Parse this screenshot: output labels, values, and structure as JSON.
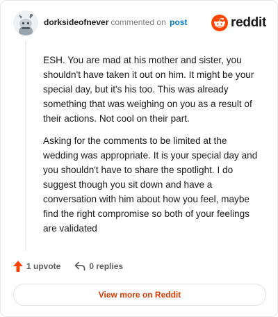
{
  "comment": {
    "username": "dorksideofnever",
    "action_text": "commented on",
    "post_link": "post",
    "paragraphs": [
      "ESH. You are mad at his mother and sister, you shouldn't have taken it out on him. It might be your special day, but it's his too. This was already something that was weighing on you as a result of their actions. Not cool on their part.",
      "Asking for the comments to be limited at the wedding was appropriate. It is your special day and you shouldn't have to share the spotlight. I do suggest though you sit down and have a conversation with him about how you feel, maybe find the right compromise so both of your feelings are validated"
    ]
  },
  "brand": {
    "name": "reddit",
    "color": "#ff4500"
  },
  "actions": {
    "upvote_label": "1 upvote",
    "replies_label": "0 replies"
  },
  "view_button": {
    "label": "View more on Reddit",
    "color": "#d93a00"
  },
  "icons": {
    "avatar": "snoo-avatar",
    "logo": "reddit-snoo-icon",
    "upvote": "upvote-arrow-icon",
    "reply": "reply-arrow-icon"
  }
}
